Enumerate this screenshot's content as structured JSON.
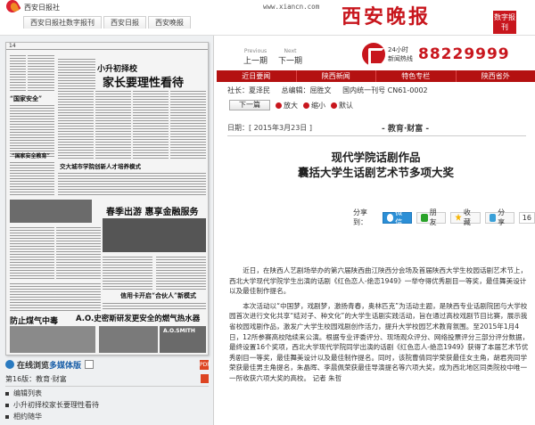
{
  "site": {
    "name": "西安日报社",
    "tabs": [
      "西安日报社数字报刊",
      "西安日报",
      "西安晚报"
    ],
    "url": "www.xiancn.com",
    "brand": "西安晚报",
    "badge": "数字报刊"
  },
  "pager": [
    {
      "en": "Previous",
      "cn": "上一期"
    },
    {
      "en": "Next",
      "cn": "下一期"
    }
  ],
  "hotline": {
    "label": "24小时\n新闻热线",
    "number": "88229999"
  },
  "nav": [
    "近日要闻",
    "陕西新闻",
    "特色专栏",
    "陕西省外"
  ],
  "meta": {
    "president": "社长：夏泽民",
    "editor": "总编辑：屈胜文",
    "issn": "国内统一刊号 CN61-0002"
  },
  "tools": {
    "next_page": "下一篇",
    "zoom_in": "放大",
    "zoom_out": "缩小",
    "default": "默认"
  },
  "date": "日期：[ 2015年3月23日 ]",
  "section": "- 教育·财富 -",
  "title_lines": [
    "现代学院话剧作品",
    "囊括大学生话剧艺术节多项大奖"
  ],
  "share": {
    "label": "分享到：",
    "buttons": [
      "微信",
      "朋友",
      "收藏",
      "分享"
    ],
    "count": "16"
  },
  "body": [
    "近日，在陕西人艺剧场举办的第六届陕西曲江陕西分会场及首届陕西大学生校园话剧艺术节上，西北大学现代学院学生出演的话剧《红色恋人-绝恋1949》一举夺得优秀剧目一等奖，最佳舞美设计以及最佳制作提名。",
    "本次活动以“中国梦，戏剧梦，激扬青春，奥林匹克”为活动主题，是陕西专业话剧院团与大学校园首次进行文化共享“结对子、种文化”的大学生话剧实践活动，旨在通过高校戏剧节目比赛，展示我省校园戏剧作品，激发广大学生校园戏剧创作活力，提升大学校园艺术教育氛围。至2015年1月4日，12所参赛高校陆续来公演。根据专业评委评分、现场观众评分、网络投票评分三部分评分数据，最终设置16个奖项，西北大学现代学院同学出演的话剧《红色恋人-绝恋1949》获得了本届艺术节优秀剧目一等奖，最佳舞美设计以及最佳制作提名。同时，该院曹倩同学荣获最佳女主角，胡君亮同学荣获最佳男主角提名，朱晶晖、李晨佩荣获最佳导演提名等六项大奖，成为西北地区同类院校中唯一一所收获六项大奖的高校。 记者 朱哲"
  ],
  "paper": {
    "page_no": "14",
    "headlines": [
      "小升初择校",
      "家长要理性看待",
      "交大城市学院创新人才培养模式",
      "春季出游  惠享金融服务",
      "防止煤气中毒",
      "A.O.史密斯研发更安全的燃气热水器",
      "信用卡开启“合伙人”新模式",
      "A.O.SMITH"
    ]
  },
  "left": {
    "read_label_a": "在线浏览",
    "read_label_b": "多媒体版",
    "edition": "第16版：教育·财富",
    "toc": [
      "编辑列表",
      "小升初择校家长要理性看待",
      "相约随华"
    ]
  }
}
